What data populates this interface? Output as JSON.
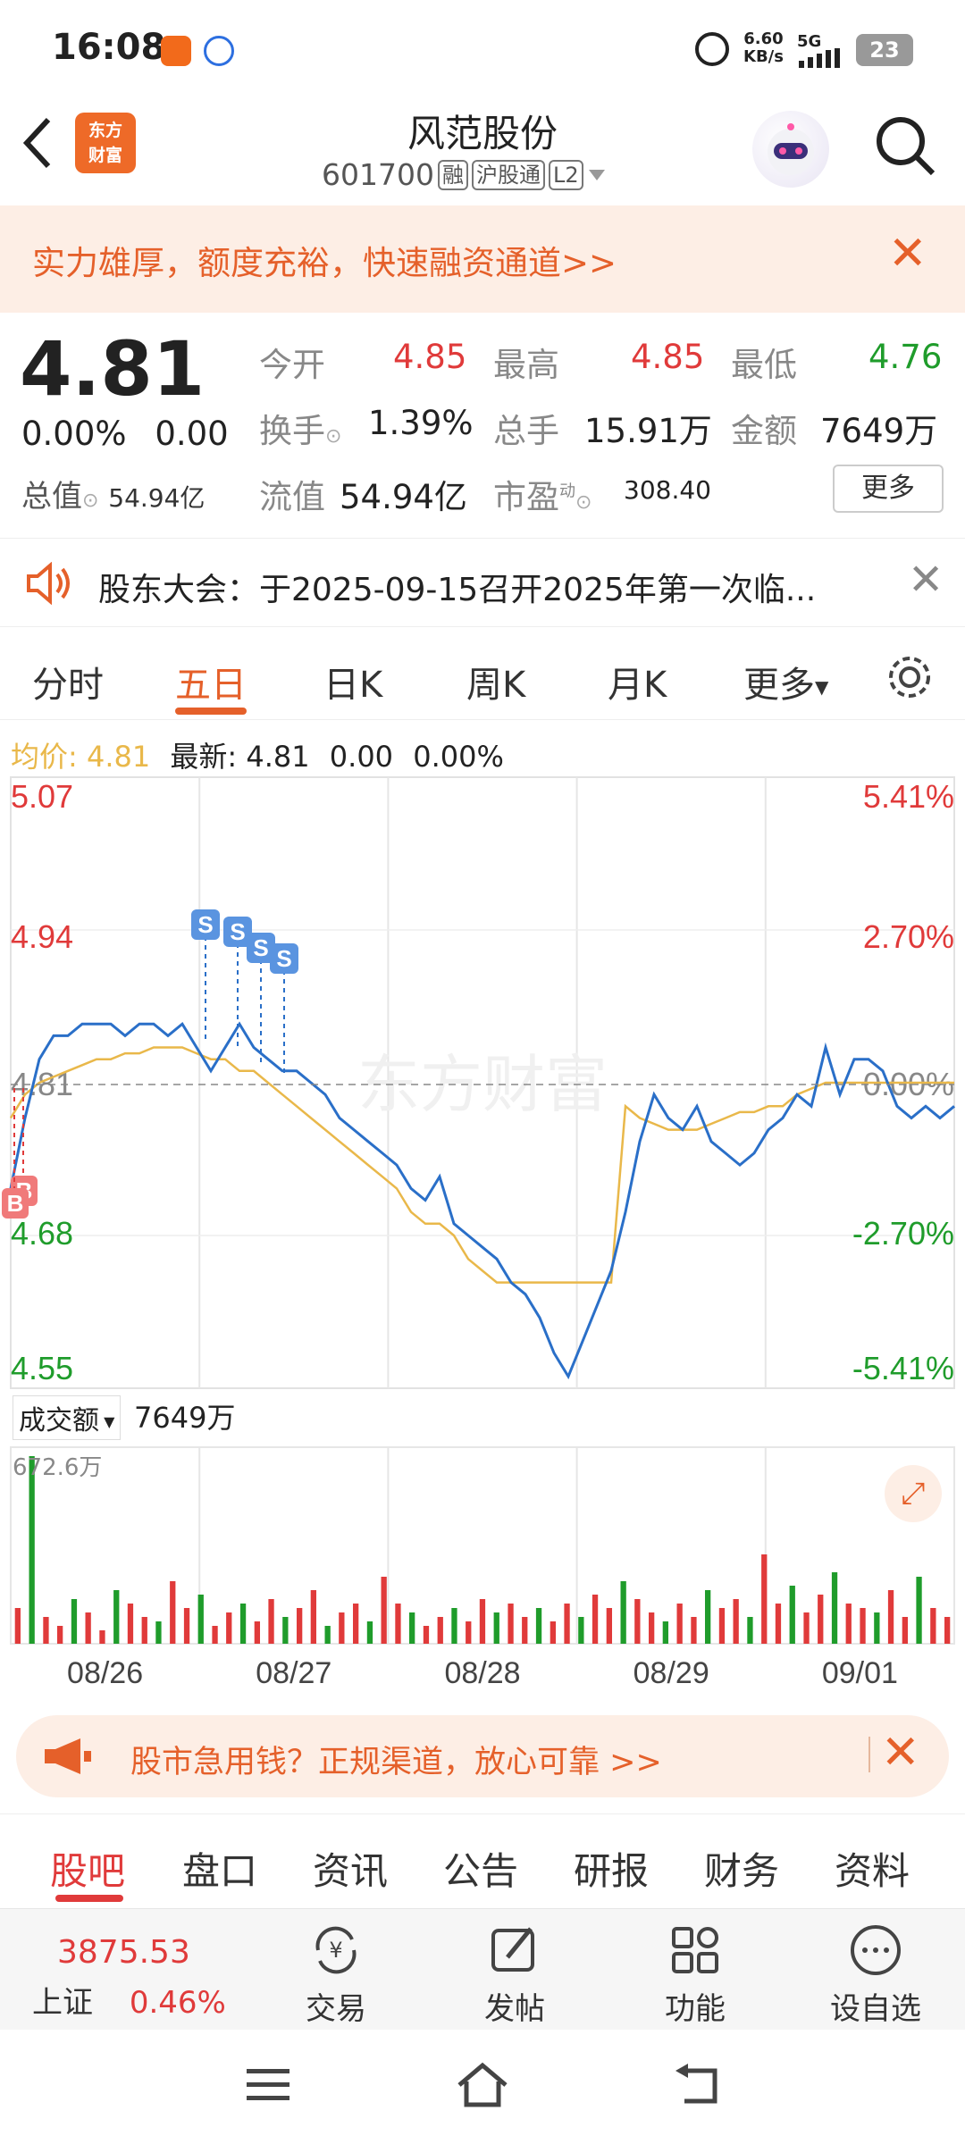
{
  "status_bar": {
    "time": "16:08",
    "net_speed": "6.60",
    "net_unit": "KB/s",
    "network": "5G",
    "battery": "23"
  },
  "header": {
    "logo_line1": "东方",
    "logo_line2": "财富",
    "title": "风范股份",
    "code": "601700",
    "tag_rong": "融",
    "tag_hgt": "沪股通",
    "tag_l2": "L2"
  },
  "banner": {
    "text": "实力雄厚，额度充裕，快速融资通道>>"
  },
  "quote": {
    "price": "4.81",
    "change_pct": "0.00%",
    "change": "0.00",
    "mkt_cap_label": "总值",
    "mkt_cap": "54.94亿",
    "open_label": "今开",
    "open": "4.85",
    "high_label": "最高",
    "high": "4.85",
    "low_label": "最低",
    "low": "4.76",
    "turnover_label": "换手",
    "turnover": "1.39%",
    "volume_label": "总手",
    "volume": "15.91万",
    "amount_label": "金额",
    "amount": "7649万",
    "float_label": "流值",
    "float_cap": "54.94亿",
    "pe_label": "市盈",
    "pe_sup": "动",
    "pe": "308.40",
    "more": "更多"
  },
  "notice": {
    "text": "股东大会：于2025-09-15召开2025年第一次临..."
  },
  "ktabs": [
    "分时",
    "五日",
    "日K",
    "周K",
    "月K",
    "更多"
  ],
  "avg_info": {
    "avg_label": "均价:",
    "avg": "4.81",
    "latest_label": "最新:",
    "latest": "4.81",
    "chg": "0.00",
    "pct": "0.00%"
  },
  "chart_data": {
    "type": "line",
    "price_axis": [
      "5.07",
      "4.94",
      "4.81",
      "4.68",
      "4.55"
    ],
    "pct_axis": [
      "5.41%",
      "2.70%",
      "0.00%",
      "-2.70%",
      "-5.41%"
    ],
    "ylim": [
      4.55,
      5.07
    ],
    "x_labels": [
      "08/26",
      "08/27",
      "08/28",
      "08/29",
      "09/01"
    ],
    "series": [
      {
        "values": [
          4.72,
          4.78,
          4.83,
          4.85,
          4.85,
          4.86,
          4.86,
          4.86,
          4.85,
          4.86,
          4.86,
          4.85,
          4.86,
          4.84,
          4.82,
          4.84,
          4.86,
          4.84,
          4.83,
          4.82,
          4.82,
          4.81,
          4.8,
          4.78,
          4.77,
          4.76,
          4.75,
          4.74,
          4.72,
          4.71,
          4.73,
          4.69,
          4.68,
          4.67,
          4.66,
          4.64,
          4.63,
          4.61,
          4.58,
          4.56,
          4.59,
          4.62,
          4.65,
          4.7,
          4.76,
          4.8,
          4.78,
          4.77,
          4.79,
          4.76,
          4.75,
          4.74,
          4.75,
          4.77,
          4.78,
          4.8,
          4.79,
          4.84,
          4.8,
          4.83,
          4.83,
          4.82,
          4.79,
          4.78,
          4.79,
          4.78,
          4.79
        ]
      },
      {
        "values": [
          4.78,
          4.8,
          4.81,
          4.815,
          4.82,
          4.825,
          4.83,
          4.83,
          4.835,
          4.835,
          4.84,
          4.84,
          4.84,
          4.835,
          4.83,
          4.83,
          4.82,
          4.82,
          4.81,
          4.8,
          4.79,
          4.78,
          4.77,
          4.76,
          4.75,
          4.74,
          4.73,
          4.72,
          4.7,
          4.69,
          4.69,
          4.68,
          4.66,
          4.65,
          4.64,
          4.64,
          4.64,
          4.64,
          4.64,
          4.64,
          4.64,
          4.64,
          4.64,
          4.79,
          4.78,
          4.775,
          4.77,
          4.77,
          4.77,
          4.775,
          4.78,
          4.785,
          4.785,
          4.79,
          4.79,
          4.8,
          4.805,
          4.81,
          4.81,
          4.81,
          4.81,
          4.81,
          4.81,
          4.81,
          4.81,
          4.81,
          4.81
        ]
      }
    ],
    "volume_label": "成交额",
    "volume_total": "7649万",
    "volume_max": "672.6万",
    "volumes": [
      8,
      42,
      6,
      4,
      10,
      7,
      3,
      12,
      9,
      6,
      5,
      14,
      8,
      11,
      4,
      7,
      9,
      5,
      10,
      6,
      8,
      12,
      4,
      7,
      9,
      5,
      15,
      9,
      7,
      4,
      6,
      8,
      5,
      10,
      7,
      9,
      6,
      8,
      5,
      9,
      6,
      11,
      8,
      14,
      10,
      7,
      5,
      9,
      6,
      12,
      8,
      10,
      6,
      20,
      9,
      13,
      7,
      11,
      16,
      9,
      8,
      7,
      12,
      6,
      15,
      8,
      6
    ],
    "colors": {
      "price": "#2a6fc8",
      "avg": "#e9b84a",
      "up": "#e03a3a",
      "down": "#1f9c2b"
    }
  },
  "promo": {
    "text": "股市急用钱？正规渠道，放心可靠 >>"
  },
  "btabs": [
    "股吧",
    "盘口",
    "资讯",
    "公告",
    "研报",
    "财务",
    "资料"
  ],
  "bottom_bar": {
    "index_value": "3875.53",
    "index_name": "上证",
    "index_pct": "0.46%",
    "trade": "交易",
    "post": "发帖",
    "func": "功能",
    "watch": "设自选"
  }
}
